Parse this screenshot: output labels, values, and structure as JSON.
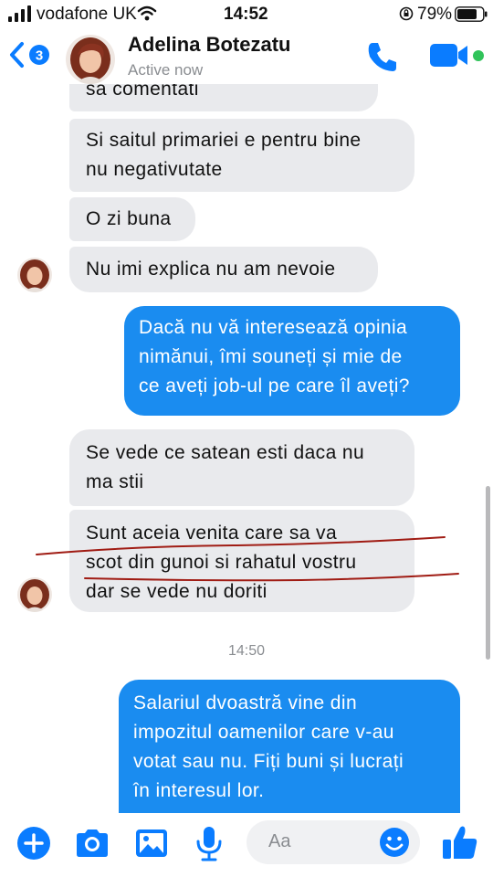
{
  "status_bar": {
    "carrier": "vodafone UK",
    "time": "14:52",
    "battery": "79%"
  },
  "header": {
    "back_count": "3",
    "contact_name": "Adelina Botezatu",
    "status": "Active now",
    "icons": [
      "back-chevron-icon",
      "phone-icon",
      "video-camera-icon"
    ]
  },
  "messages": [
    {
      "from": "contact",
      "text": "sa comentati"
    },
    {
      "from": "contact",
      "text": "Si saitul primariei e pentru bine\nnu negativutate"
    },
    {
      "from": "contact",
      "text": "O zi buna"
    },
    {
      "from": "contact",
      "text": "Nu imi explica nu am nevoie"
    },
    {
      "from": "me",
      "text": "Dacă nu vă interesează opinia\nnimănui, îmi souneți și mie de\nce aveți job-ul pe care îl aveți?"
    },
    {
      "from": "contact",
      "text": "Se vede ce satean esti daca nu\nma stii"
    },
    {
      "from": "contact",
      "text": "Sunt aceia venita care sa va\nscot din gunoi si rahatul vostru\ndar se vede nu doriti"
    },
    {
      "from": "me",
      "text": "Salariul dvoastră vine din\nimpozitul oamenilor care v-au\nvotat sau nu. Fiți buni și lucrați\nîn interesul lor."
    }
  ],
  "timestamp": "14:50",
  "composer": {
    "placeholder": "Aa",
    "icons": [
      "plus-icon",
      "camera-icon",
      "gallery-icon",
      "microphone-icon",
      "emoji-icon",
      "thumbs-up-icon"
    ]
  },
  "colors": {
    "accent": "#0a7cff",
    "outgoing_bubble": "#1a8cf0",
    "incoming_bubble": "#e9eaed",
    "online": "#31c35a"
  }
}
